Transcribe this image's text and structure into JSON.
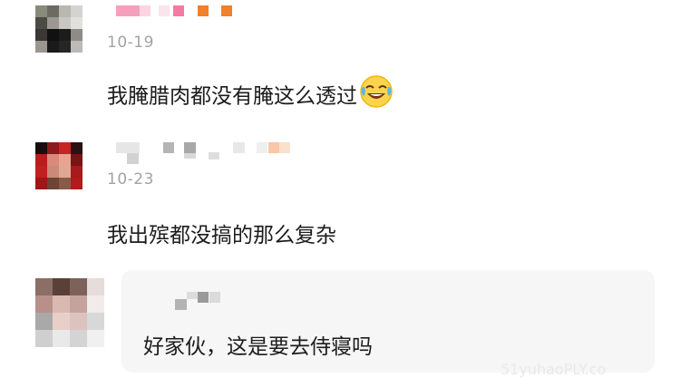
{
  "comments": [
    {
      "date": "10-19",
      "text": "我腌腊肉都没有腌这么透过",
      "emoji": "laughing-tears-emoji",
      "avatar_colors": [
        "#8a8a7a",
        "#6b6b63",
        "#b9b7b0",
        "#d5d3cf",
        "#4b4b45",
        "#9a9890",
        "#c9c7c2",
        "#e2e0dc",
        "#3a3734",
        "#111111",
        "#1c1c1c",
        "#8d8b86",
        "#9c978e",
        "#1a1a1a",
        "#262626",
        "#bdbab5"
      ]
    },
    {
      "date": "10-23",
      "text": "我出殡都没搞的那么复杂",
      "avatar_colors": [
        "#1a0d0d",
        "#8a1c1c",
        "#c72424",
        "#2b1111",
        "#b81e1e",
        "#d98a7a",
        "#e6a591",
        "#7a1414",
        "#c21f1f",
        "#c98b78",
        "#e0a894",
        "#a61b1b",
        "#9e1616",
        "#6e4434",
        "#8a5a48",
        "#b21b1b"
      ]
    }
  ],
  "reply": {
    "text": "好家伙，这是要去侍寝吗",
    "avatar_colors": [
      "#8b6f66",
      "#5a4039",
      "#7c625b",
      "#e6dcd9",
      "#b8908a",
      "#d9b9b2",
      "#c4a39c",
      "#f1ebe9",
      "#a9a9a9",
      "#e8cfc8",
      "#dcc3bd",
      "#d8d8d8",
      "#cfcfcf",
      "#e9e9e9",
      "#d4d4d4",
      "#f0f0f0"
    ]
  },
  "colors": {
    "name_pink": "#f47aa3",
    "name_orange": "#f0802a",
    "name_gray": "#c8c8c8"
  },
  "watermark": "51yuhaoPLY.co"
}
